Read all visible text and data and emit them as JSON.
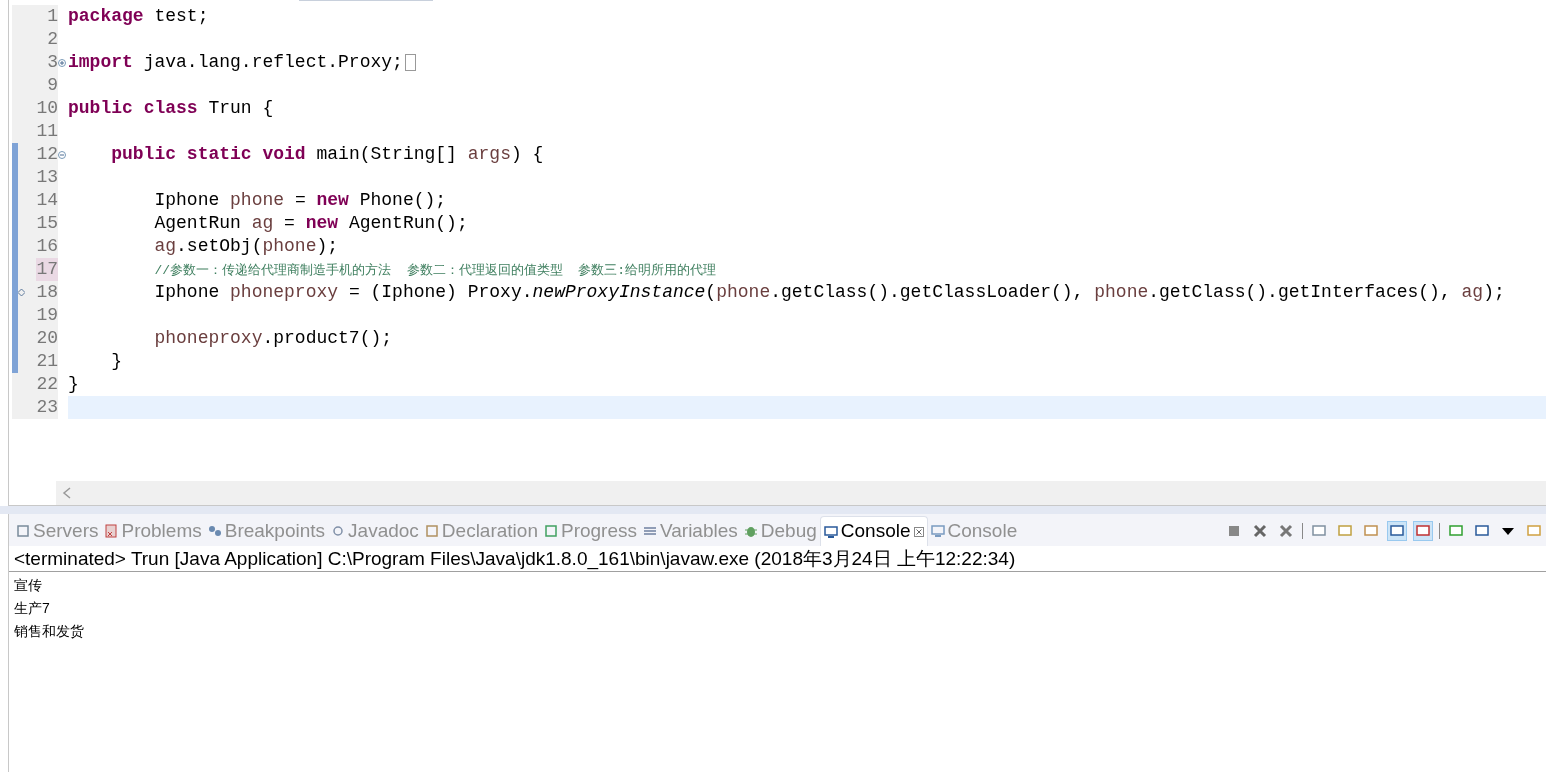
{
  "editor": {
    "lines": [
      {
        "number": "1",
        "tokens": [
          {
            "kind": "keyword",
            "text": "package"
          },
          {
            "kind": "plain",
            "text": " test;"
          }
        ]
      },
      {
        "number": "2"
      },
      {
        "number": "3",
        "fold_expanded": false,
        "folded": true,
        "tokens": [
          {
            "kind": "keyword",
            "text": "import"
          },
          {
            "kind": "plain",
            "text": " java.lang.reflect.Proxy;"
          }
        ]
      },
      {
        "number": "9"
      },
      {
        "number": "10",
        "tokens": [
          {
            "kind": "keyword",
            "text": "public"
          },
          {
            "kind": "keyword",
            "text": " class"
          },
          {
            "kind": "plain",
            "text": " Trun {"
          }
        ]
      },
      {
        "number": "11"
      },
      {
        "number": "12",
        "fold_expanded": true,
        "changed": true,
        "tokens": [
          {
            "kind": "keyword",
            "text": "    public"
          },
          {
            "kind": "keyword",
            "text": " static"
          },
          {
            "kind": "keyword",
            "text": " void"
          },
          {
            "kind": "plain",
            "text": " main(String[] "
          },
          {
            "kind": "variable",
            "text": "args"
          },
          {
            "kind": "plain",
            "text": ") {"
          }
        ]
      },
      {
        "number": "13",
        "changed": true
      },
      {
        "number": "14",
        "changed": true,
        "tokens": [
          {
            "kind": "plain",
            "text": "        Iphone "
          },
          {
            "kind": "variable",
            "text": "phone"
          },
          {
            "kind": "plain",
            "text": " = "
          },
          {
            "kind": "keyword",
            "text": "new"
          },
          {
            "kind": "plain",
            "text": " Phone();"
          }
        ]
      },
      {
        "number": "15",
        "changed": true,
        "tokens": [
          {
            "kind": "plain",
            "text": "        AgentRun "
          },
          {
            "kind": "variable",
            "text": "ag"
          },
          {
            "kind": "plain",
            "text": " = "
          },
          {
            "kind": "keyword",
            "text": "new"
          },
          {
            "kind": "plain",
            "text": " AgentRun();"
          }
        ]
      },
      {
        "number": "16",
        "changed": true,
        "tokens": [
          {
            "kind": "variable",
            "text": "        ag"
          },
          {
            "kind": "plain",
            "text": ".setObj("
          },
          {
            "kind": "variable",
            "text": "phone"
          },
          {
            "kind": "plain",
            "text": ");"
          }
        ]
      },
      {
        "number": "17",
        "changed": true,
        "marked": true,
        "tokens": [
          {
            "kind": "comment",
            "text": "        //参数一：传递给代理商制造手机的方法  参数二：代理返回的值类型  参数三:给明所用的代理"
          }
        ]
      },
      {
        "number": "18",
        "changed": true,
        "ruler_mark": true,
        "tokens": [
          {
            "kind": "plain",
            "text": "        Iphone "
          },
          {
            "kind": "variable",
            "text": "phoneproxy"
          },
          {
            "kind": "plain",
            "text": " = (Iphone) Proxy."
          },
          {
            "kind": "italic",
            "text": "newProxyInstance"
          },
          {
            "kind": "plain",
            "text": "("
          },
          {
            "kind": "variable",
            "text": "phone"
          },
          {
            "kind": "plain",
            "text": ".getClass().getClassLoader(), "
          },
          {
            "kind": "variable",
            "text": "phone"
          },
          {
            "kind": "plain",
            "text": ".getClass().getInterfaces(), "
          },
          {
            "kind": "variable",
            "text": "ag"
          },
          {
            "kind": "plain",
            "text": ");"
          }
        ]
      },
      {
        "number": "19",
        "changed": true
      },
      {
        "number": "20",
        "changed": true,
        "tokens": [
          {
            "kind": "variable",
            "text": "        phoneproxy"
          },
          {
            "kind": "plain",
            "text": ".product7();"
          }
        ]
      },
      {
        "number": "21",
        "changed": true,
        "tokens": [
          {
            "kind": "plain",
            "text": "    }"
          }
        ]
      },
      {
        "number": "22",
        "tokens": [
          {
            "kind": "plain",
            "text": "}"
          }
        ]
      },
      {
        "number": "23",
        "current": true
      }
    ]
  },
  "panel": {
    "tabs": [
      {
        "label": "Servers",
        "selected": false
      },
      {
        "label": "Problems",
        "selected": false
      },
      {
        "label": "Breakpoints",
        "selected": false
      },
      {
        "label": "Javadoc",
        "selected": false
      },
      {
        "label": "Declaration",
        "selected": false
      },
      {
        "label": "Progress",
        "selected": false
      },
      {
        "label": "Variables",
        "selected": false
      },
      {
        "label": "Debug",
        "selected": false
      },
      {
        "label": "Console",
        "selected": true
      },
      {
        "label": "Console",
        "selected": false
      }
    ],
    "toolbar": [
      {
        "pressed": false
      },
      {
        "pressed": false
      },
      {
        "pressed": false
      },
      {
        "pressed": false
      },
      {
        "pressed": false
      },
      {
        "pressed": false
      },
      {
        "pressed": true
      },
      {
        "pressed": true
      },
      {
        "pressed": false
      },
      {
        "pressed": false
      },
      {
        "pressed": false
      },
      {
        "pressed": false
      }
    ],
    "console_header": "<terminated> Trun [Java Application] C:\\Program Files\\Java\\jdk1.8.0_161\\bin\\javaw.exe (2018年3月24日 上午12:22:34)",
    "output": [
      "宣传",
      "生产7",
      "销售和发货"
    ]
  }
}
